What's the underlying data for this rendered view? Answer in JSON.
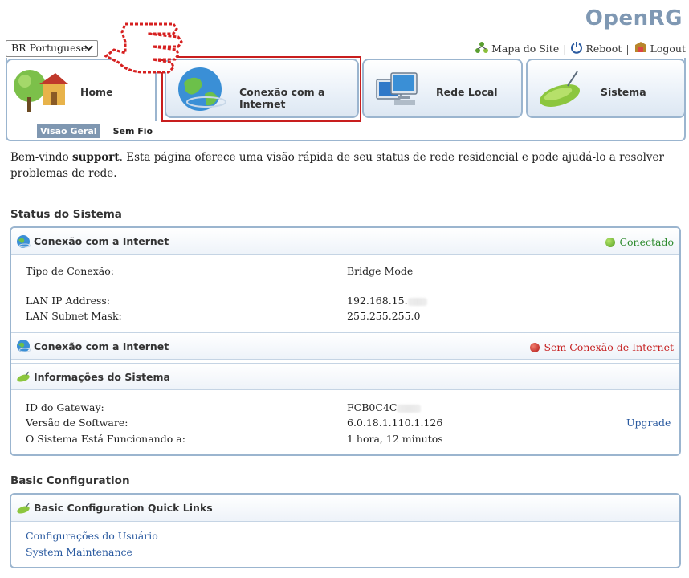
{
  "brand": {
    "logo_text": "OpenRG"
  },
  "language": {
    "selected": "BR Portuguese"
  },
  "top_links": {
    "site_map": "Mapa do Site",
    "reboot": "Reboot",
    "logout": "Logout",
    "separator": "|"
  },
  "tabs": [
    {
      "label": "Home"
    },
    {
      "label": "Conexão com a Internet"
    },
    {
      "label": "Rede Local"
    },
    {
      "label": "Sistema"
    }
  ],
  "subtabs": [
    {
      "label": "Visão Geral"
    },
    {
      "label": "Sem Fio"
    }
  ],
  "welcome": {
    "prefix": "Bem-vindo ",
    "user": "support",
    "suffix": ". Esta página oferece uma visão rápida de seu status de rede residencial e pode ajudá-lo a resolver problemas de rede."
  },
  "system_status": {
    "title": "Status do Sistema",
    "internet1": {
      "title": "Conexão com a Internet",
      "status": "Conectado",
      "status_color": "#2e8b2e",
      "rows": [
        {
          "label": "Tipo de Conexão:",
          "value": "Bridge Mode"
        },
        {
          "label": "LAN IP Address:",
          "value": "192.168.15."
        },
        {
          "label": "LAN Subnet Mask:",
          "value": "255.255.255.0"
        }
      ]
    },
    "internet2": {
      "title": "Conexão com a Internet",
      "status": "Sem Conexão de Internet",
      "status_color": "#c62020"
    },
    "sysinfo": {
      "title": "Informações do Sistema",
      "rows": [
        {
          "label": "ID do Gateway:",
          "value": "FCB0C4C"
        },
        {
          "label": "Versão de Software:",
          "value": "6.0.18.1.110.1.126"
        },
        {
          "label": "O Sistema Está Funcionando a:",
          "value": "1 hora, 12 minutos"
        }
      ],
      "upgrade_link": "Upgrade"
    }
  },
  "basic_config": {
    "title": "Basic Configuration",
    "panel_title": "Basic Configuration Quick Links",
    "links": [
      "Configurações do Usuário",
      "System Maintenance"
    ]
  },
  "colors": {
    "accent": "#9bb5cf",
    "link": "#2a5aa0",
    "highlight": "#c81e1e"
  }
}
